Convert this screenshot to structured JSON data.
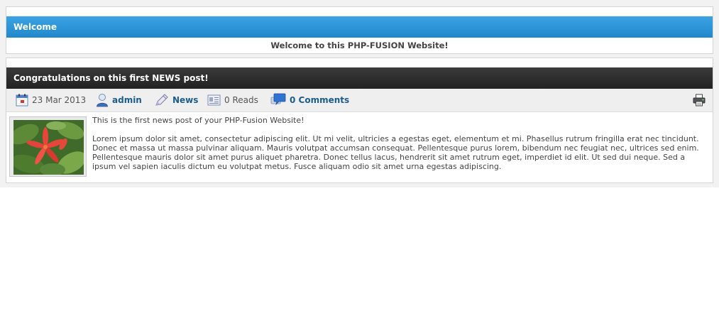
{
  "welcome": {
    "title": "Welcome",
    "message": "Welcome to this PHP-FUSION Website!"
  },
  "news": {
    "title": "Congratulations on this first NEWS post!",
    "meta": {
      "date": "23 Mar 2013",
      "author": "admin",
      "category": "News",
      "reads": "0 Reads",
      "comments": "0 Comments"
    },
    "intro": "This is the first news post of your PHP-Fusion Website!",
    "body": "Lorem ipsum dolor sit amet, consectetur adipiscing elit. Ut mi velit, ultricies a egestas eget, elementum et mi. Phasellus rutrum fringilla erat nec tincidunt. Donec et massa ut massa pulvinar aliquam. Mauris volutpat accumsan consequat. Pellentesque purus lorem, bibendum nec feugiat nec, ultrices sed enim. Pellentesque mauris dolor sit amet purus aliquet pharetra. Donec tellus lacus, hendrerit sit amet rutrum eget, imperdiet id elit. Ut sed dui neque. Sed a ipsum vel sapien iaculis dictum eu volutpat metus. Fusce aliquam odio sit amet urna egestas adipiscing."
  },
  "icons": {
    "date": "calendar-icon",
    "author": "user-icon",
    "category": "pencil-icon",
    "reads": "reads-icon",
    "comments": "comment-icon",
    "print": "printer-icon"
  },
  "colors": {
    "welcome_bar": "#2a95d8",
    "news_bar": "#2b2b2b",
    "link": "#1b5c8c"
  }
}
